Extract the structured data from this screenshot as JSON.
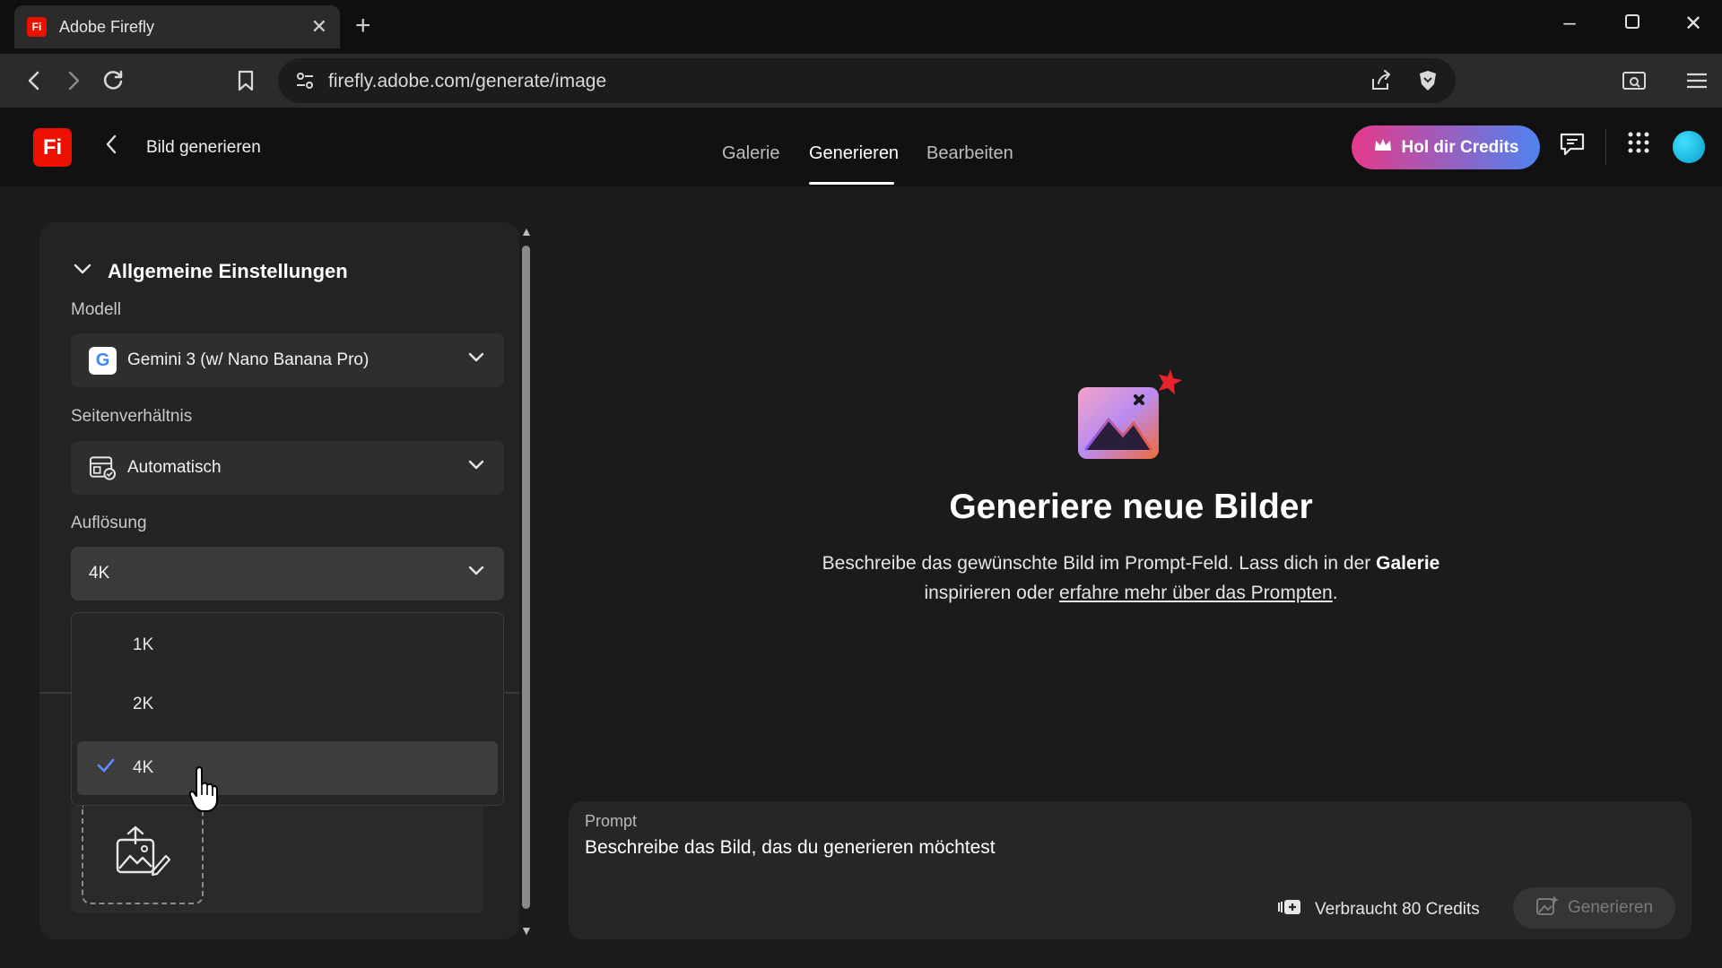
{
  "browser": {
    "tab_title": "Adobe Firefly",
    "favicon_text": "Fi",
    "url": "firefly.adobe.com/generate/image"
  },
  "app": {
    "logo_text": "Fi",
    "page_title": "Bild generieren",
    "nav": {
      "gallery": "Galerie",
      "generate": "Generieren",
      "edit": "Bearbeiten",
      "active": "Generieren"
    },
    "credits_button": "Hol dir Credits",
    "colors": {
      "brand_red": "#eb1000",
      "credits_gradient_start": "#e53a8a",
      "credits_gradient_end": "#4f83f0",
      "check_blue": "#5b8cff"
    }
  },
  "settings": {
    "section_title": "Allgemeine Einstellungen",
    "model": {
      "label": "Modell",
      "value": "Gemini 3 (w/ Nano Banana Pro)",
      "icon": "google-g-icon"
    },
    "aspect_ratio": {
      "label": "Seitenverhältnis",
      "value": "Automatisch",
      "icon": "aspect-ratio-auto-icon"
    },
    "resolution": {
      "label": "Auflösung",
      "value": "4K",
      "options": [
        "1K",
        "2K",
        "4K"
      ],
      "selected": "4K"
    }
  },
  "empty_state": {
    "title": "Generiere neue Bilder",
    "desc_part1": "Beschreibe das gewünschte Bild im Prompt-Feld. Lass dich in der ",
    "desc_bold": "Galerie",
    "desc_part2": " inspirieren oder ",
    "desc_link": "erfahre mehr über das Prompten",
    "desc_end": "."
  },
  "prompt": {
    "label": "Prompt",
    "placeholder": "Beschreibe das Bild, das du generieren möchtest",
    "credits_text": "Verbraucht 80 Credits",
    "generate_button": "Generieren"
  }
}
